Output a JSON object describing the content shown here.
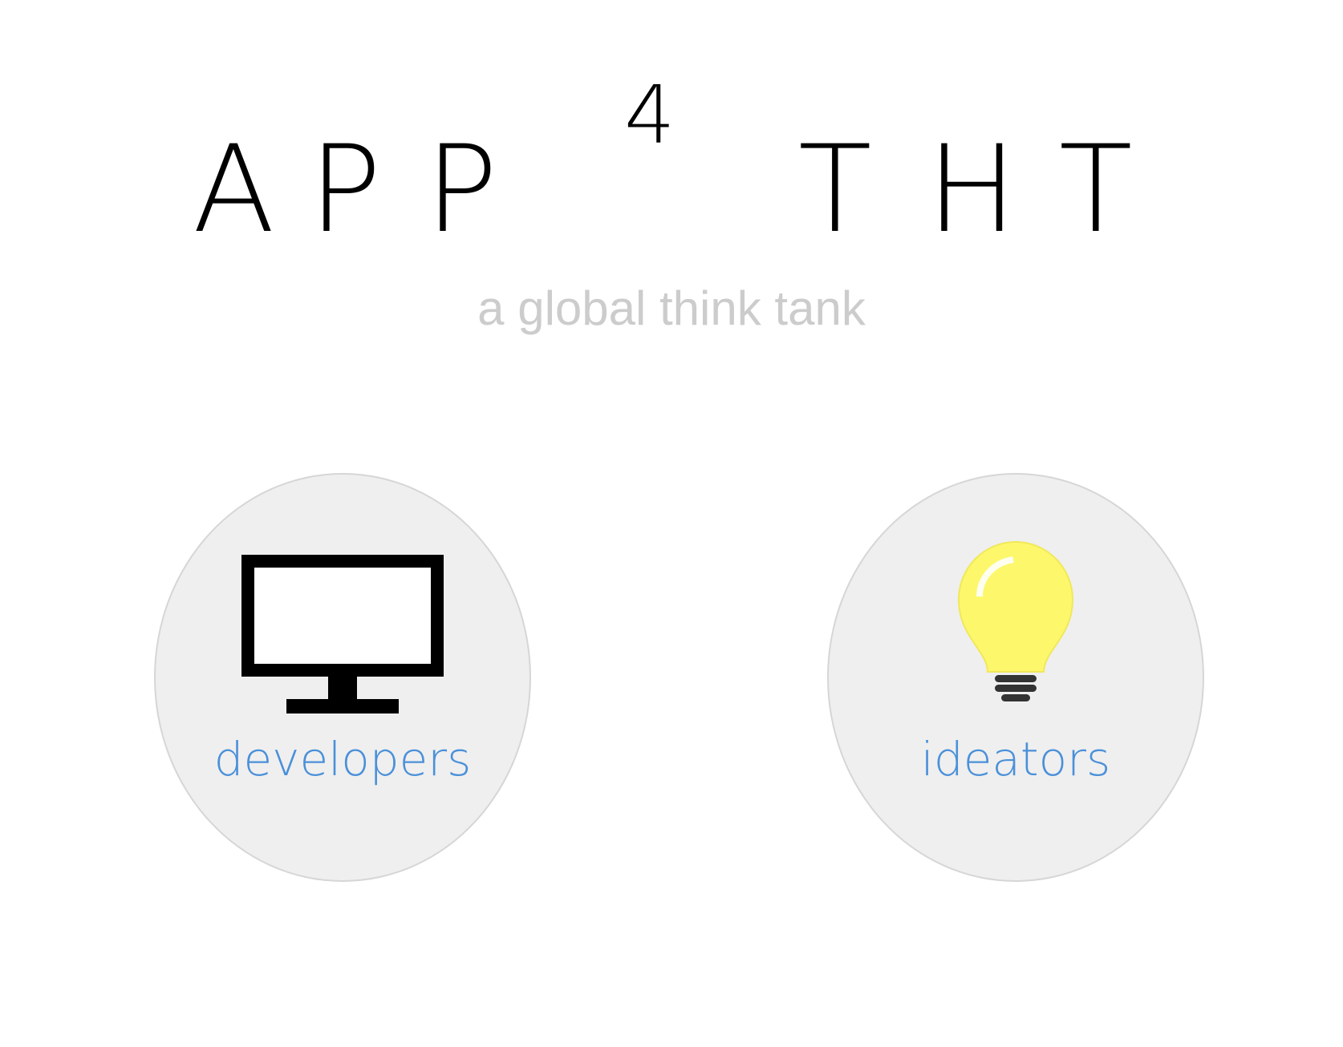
{
  "header": {
    "logo_letters": [
      "A",
      "P",
      "P",
      "T",
      "H",
      "T"
    ],
    "logo_superscript": "4",
    "tagline": "a global think tank"
  },
  "roles": [
    {
      "label": "developers",
      "icon": "monitor-icon"
    },
    {
      "label": "ideators",
      "icon": "lightbulb-icon"
    }
  ],
  "colors": {
    "background": "#ffffff",
    "logo": "#000000",
    "tagline": "#cccccc",
    "card_fill": "#efefef",
    "card_border": "#d6d6d6",
    "label": "#4a90d9",
    "bulb": "#fdf86b"
  }
}
